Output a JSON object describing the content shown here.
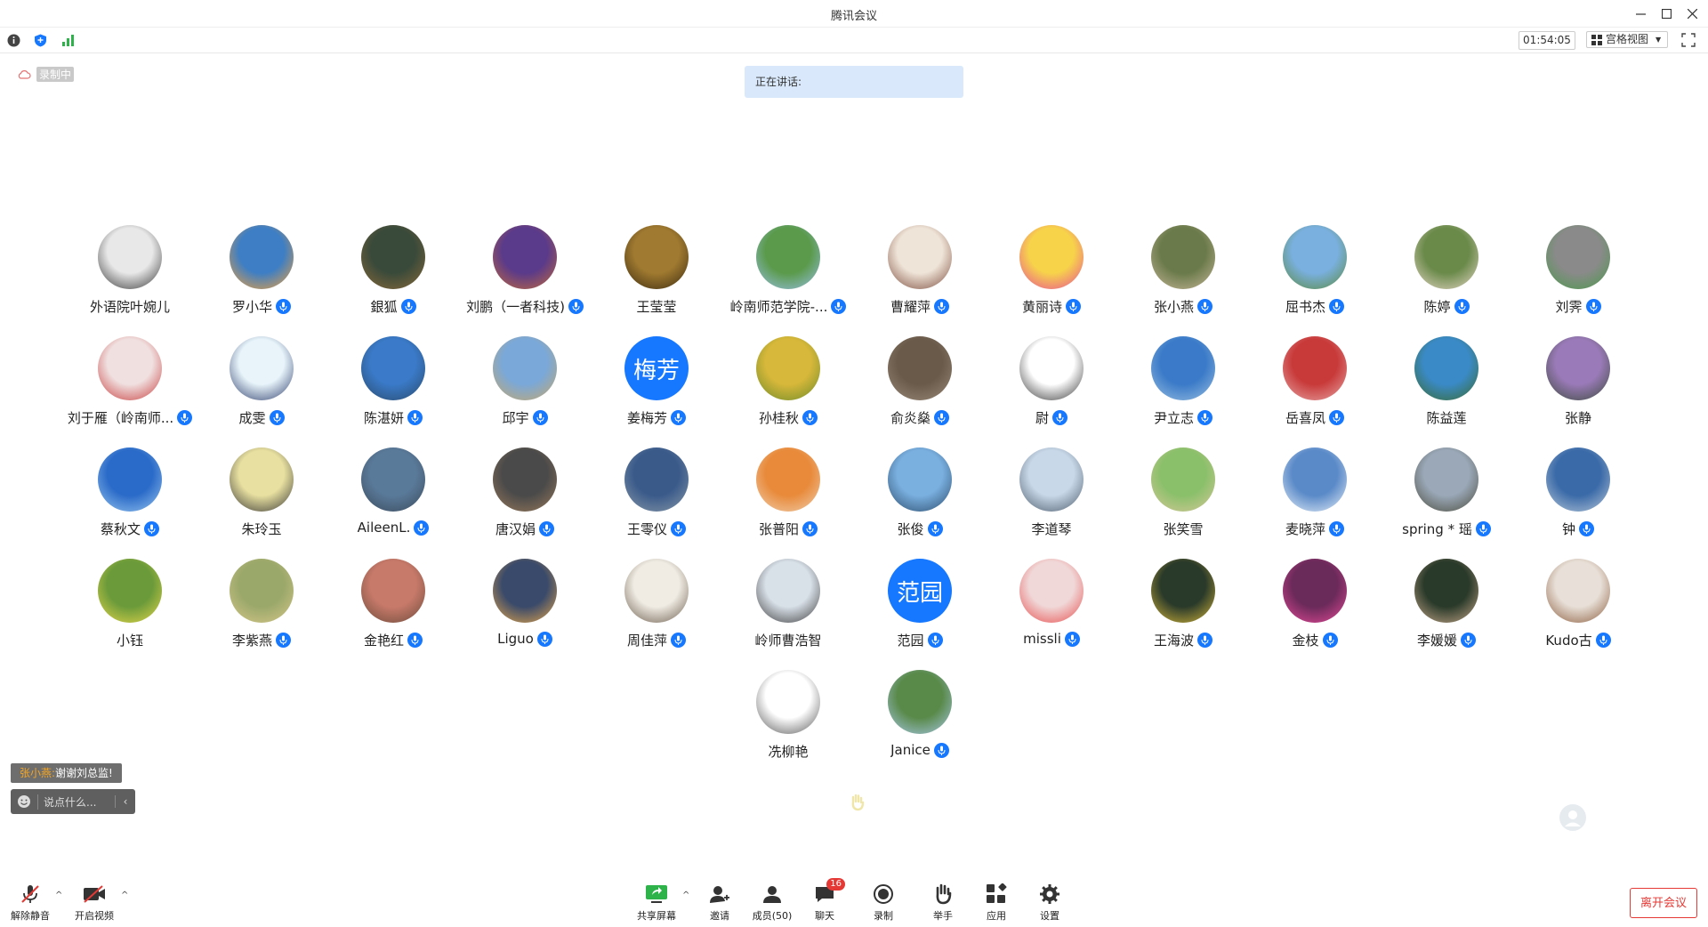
{
  "window": {
    "title": "腾讯会议"
  },
  "topbar": {
    "timer": "01:54:05",
    "view_label": "宫格视图"
  },
  "recording": {
    "label": "录制中"
  },
  "speaking": {
    "label": "正在讲话:"
  },
  "participants": [
    {
      "name": "外语院叶婉儿",
      "mic": false,
      "photo": [
        "#e8e8e8",
        "#333"
      ]
    },
    {
      "name": "罗小华",
      "mic": true,
      "photo": [
        "#3d7ec4",
        "#f4a23a"
      ]
    },
    {
      "name": "銀狐",
      "mic": true,
      "photo": [
        "#3a4a3a",
        "#8b6a3a"
      ]
    },
    {
      "name": "刘鹏（一者科技)",
      "mic": true,
      "photo": [
        "#5a3a8a",
        "#c46a3a"
      ]
    },
    {
      "name": "王莹莹",
      "mic": false,
      "photo": [
        "#a07a30",
        "#3a2a10"
      ]
    },
    {
      "name": "岭南师范学院-...",
      "mic": true,
      "photo": [
        "#5a9a4a",
        "#9ac0e8"
      ]
    },
    {
      "name": "曹耀萍",
      "mic": true,
      "photo": [
        "#efe4d8",
        "#7a4a3a"
      ]
    },
    {
      "name": "黄丽诗",
      "mic": true,
      "photo": [
        "#f7d34a",
        "#e84a9a"
      ]
    },
    {
      "name": "张小燕",
      "mic": true,
      "photo": [
        "#6a7a4a",
        "#c8b89a"
      ]
    },
    {
      "name": "屈书杰",
      "mic": true,
      "photo": [
        "#7ab0e0",
        "#5a8a3a"
      ]
    },
    {
      "name": "陈婷",
      "mic": true,
      "photo": [
        "#6a8a4a",
        "#e8d8c8"
      ]
    },
    {
      "name": "刘霁",
      "mic": true,
      "photo": [
        "#8a8a8a",
        "#4a9a4a"
      ]
    },
    {
      "name": "刘于雁（岭南师...",
      "mic": true,
      "photo": [
        "#f0e0e0",
        "#c83a3a"
      ]
    },
    {
      "name": "成雯",
      "mic": true,
      "photo": [
        "#e8f4fa",
        "#2a3a6a"
      ]
    },
    {
      "name": "陈湛妍",
      "mic": true,
      "photo": [
        "#3a7ac8",
        "#2a4a6a"
      ]
    },
    {
      "name": "邱宇",
      "mic": true,
      "photo": [
        "#7aa8d8",
        "#c8a86a"
      ]
    },
    {
      "name": "姜梅芳",
      "mic": true,
      "text": "梅芳"
    },
    {
      "name": "孙桂秋",
      "mic": true,
      "photo": [
        "#d8b83a",
        "#6a8a2a"
      ]
    },
    {
      "name": "俞炎燊",
      "mic": true,
      "photo": [
        "#6a5a4a",
        "#9a8a7a"
      ]
    },
    {
      "name": "尉",
      "mic": true,
      "photo": [
        "#ffffff",
        "#333333"
      ]
    },
    {
      "name": "尹立志",
      "mic": true,
      "photo": [
        "#3a7ac8",
        "#9ac0e0"
      ]
    },
    {
      "name": "岳喜凤",
      "mic": true,
      "photo": [
        "#c83a3a",
        "#e8a8a8"
      ]
    },
    {
      "name": "陈益莲",
      "mic": false,
      "photo": [
        "#3a8ac8",
        "#3a6a2a"
      ]
    },
    {
      "name": "张静",
      "mic": false,
      "photo": [
        "#9a7ab8",
        "#3a4a3a"
      ]
    },
    {
      "name": "蔡秋文",
      "mic": true,
      "photo": [
        "#2a6ac8",
        "#9ac8f0"
      ]
    },
    {
      "name": "朱玲玉",
      "mic": false,
      "photo": [
        "#e8e0a0",
        "#333333"
      ]
    },
    {
      "name": "AileenL.",
      "mic": true,
      "photo": [
        "#5a7a9a",
        "#3a4a5a"
      ]
    },
    {
      "name": "唐汉娟",
      "mic": true,
      "photo": [
        "#4a4a4a",
        "#9a7a5a"
      ]
    },
    {
      "name": "王零仪",
      "mic": true,
      "photo": [
        "#3a5a8a",
        "#8a9aa8"
      ]
    },
    {
      "name": "张普阳",
      "mic": true,
      "photo": [
        "#e88a3a",
        "#f0d0b0"
      ]
    },
    {
      "name": "张俊",
      "mic": true,
      "photo": [
        "#7ab0e0",
        "#2a4a6a"
      ]
    },
    {
      "name": "李道琴",
      "mic": false,
      "photo": [
        "#c8d8e8",
        "#4a5a6a"
      ]
    },
    {
      "name": "张笑雪",
      "mic": false,
      "photo": [
        "#8ac06a",
        "#d8c89a"
      ]
    },
    {
      "name": "麦晓萍",
      "mic": true,
      "photo": [
        "#5a8ac8",
        "#e8f0f8"
      ]
    },
    {
      "name": "spring * 瑶",
      "mic": true,
      "photo": [
        "#9aa8b8",
        "#4a4a3a"
      ]
    },
    {
      "name": "钟",
      "mic": true,
      "photo": [
        "#3a6aa8",
        "#b8c8d8"
      ]
    },
    {
      "name": "小钰",
      "mic": false,
      "photo": [
        "#6a9a3a",
        "#e8d84a"
      ]
    },
    {
      "name": "李紫燕",
      "mic": true,
      "photo": [
        "#9aa86a",
        "#d8c88a"
      ]
    },
    {
      "name": "金艳红",
      "mic": true,
      "photo": [
        "#c87a6a",
        "#6a4a3a"
      ]
    },
    {
      "name": "Liguo",
      "mic": true,
      "photo": [
        "#3a4a6a",
        "#e8a84a"
      ]
    },
    {
      "name": "周佳萍",
      "mic": true,
      "photo": [
        "#f0ece4",
        "#6a5a4a"
      ]
    },
    {
      "name": "岭师曹浩智",
      "mic": false,
      "photo": [
        "#d8e0e8",
        "#3a3a3a"
      ]
    },
    {
      "name": "范园",
      "mic": true,
      "text": "范园"
    },
    {
      "name": "missli",
      "mic": true,
      "photo": [
        "#f0d8d8",
        "#e84a4a"
      ]
    },
    {
      "name": "王海波",
      "mic": true,
      "photo": [
        "#2a3a2a",
        "#d8b83a"
      ]
    },
    {
      "name": "金枝",
      "mic": true,
      "photo": [
        "#6a2a5a",
        "#e84a9a"
      ]
    },
    {
      "name": "李媛媛",
      "mic": true,
      "photo": [
        "#2a3a2a",
        "#c8a88a"
      ]
    },
    {
      "name": "Kudo古",
      "mic": true,
      "photo": [
        "#e8e0d8",
        "#8a5a3a"
      ]
    },
    {
      "name": "冼柳艳",
      "mic": false,
      "photo": [
        "#ffffff",
        "#555555"
      ]
    },
    {
      "name": "Janice",
      "mic": true,
      "photo": [
        "#5a8a4a",
        "#a8c8e8"
      ]
    }
  ],
  "chat": {
    "sender": "张小燕:",
    "message": "谢谢刘总监!",
    "input_placeholder": "说点什么..."
  },
  "toolbar": {
    "unmute": "解除静音",
    "video": "开启视频",
    "share": "共享屏幕",
    "invite": "邀请",
    "members": "成员(50)",
    "chat": "聊天",
    "chat_badge": "16",
    "record": "录制",
    "raise_hand": "举手",
    "apps": "应用",
    "settings": "设置",
    "leave": "离开会议"
  },
  "colors": {
    "accent": "#1677ff",
    "leave": "#e53935",
    "speaking_bg": "#d9e9fb"
  }
}
